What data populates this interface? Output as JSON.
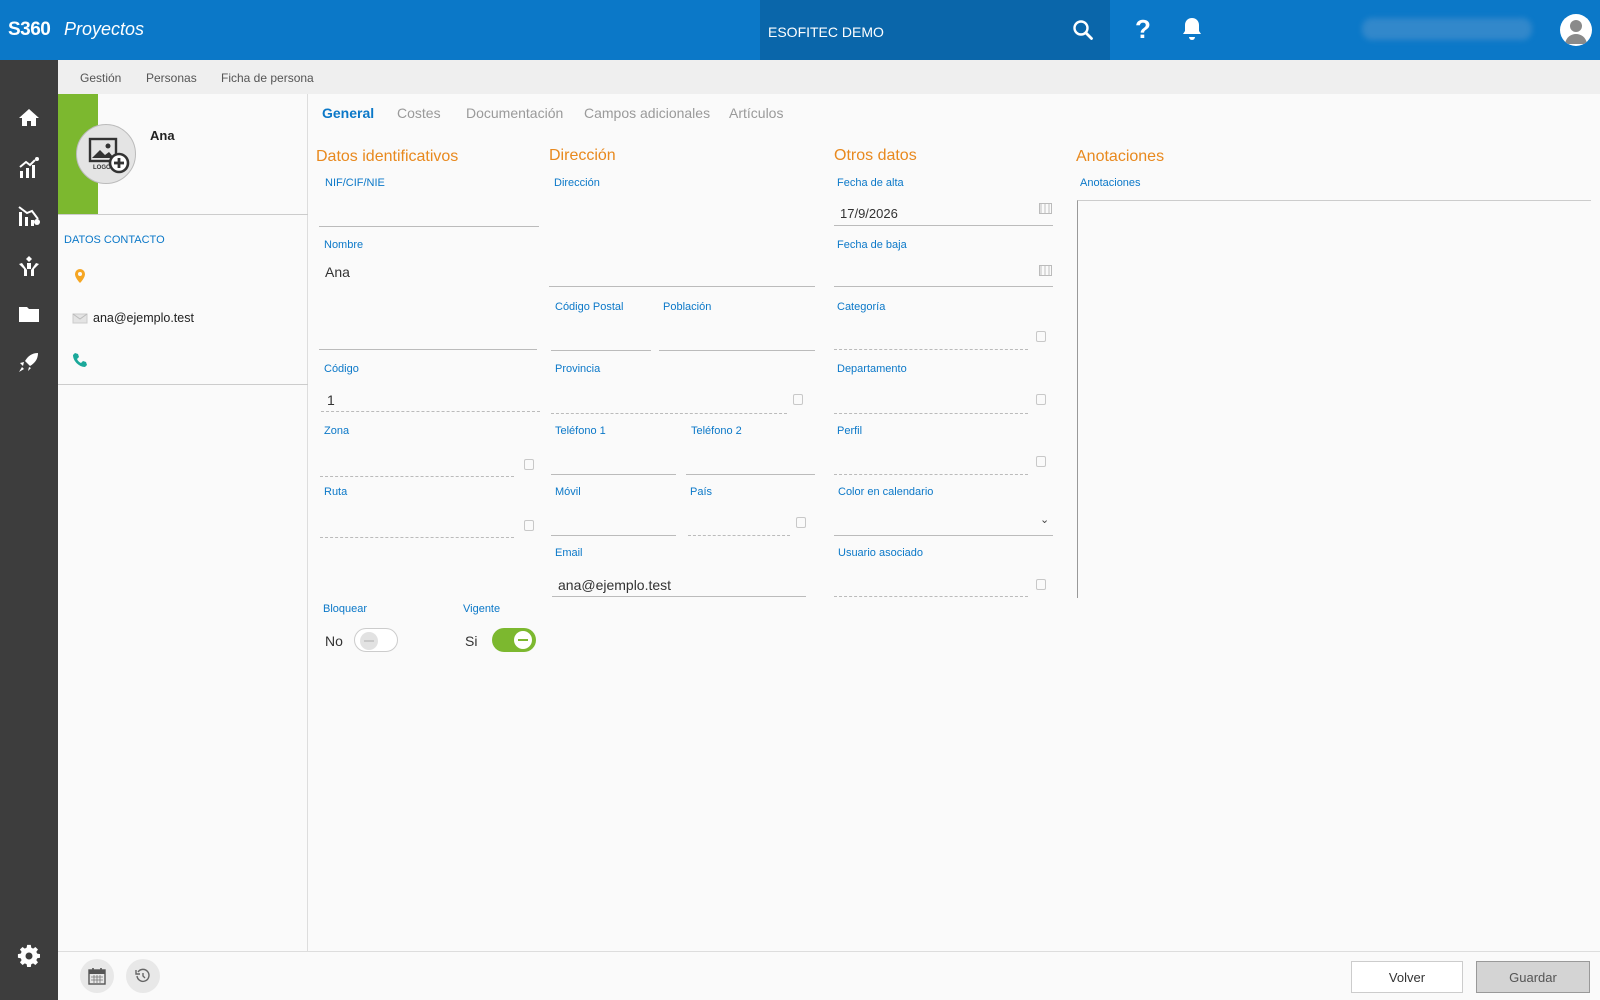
{
  "header": {
    "brand": "S360",
    "app_name": "Proyectos",
    "company": "ESOFITEC DEMO",
    "help_label": "?",
    "accent_color": "#0b78c8"
  },
  "sidebar": {
    "icons": [
      "home-icon",
      "analytics-icon",
      "projects-chart-icon",
      "hands-care-icon",
      "folder-icon",
      "rocket-icon",
      "gear-icon"
    ]
  },
  "breadcrumb": {
    "items": [
      "Gestión",
      "Personas",
      "Ficha de persona"
    ]
  },
  "profile": {
    "name": "Ana",
    "logo_text": "LOGO",
    "contact_title": "DATOS CONTACTO",
    "email": "ana@ejemplo.test"
  },
  "tabs": [
    "General",
    "Costes",
    "Documentación",
    "Campos adicionales",
    "Artículos"
  ],
  "sections": {
    "identificativos": "Datos identificativos",
    "direccion": "Dirección",
    "otros": "Otros datos",
    "anotaciones": "Anotaciones"
  },
  "fields": {
    "nif": {
      "label": "NIF/CIF/NIE",
      "value": ""
    },
    "nombre": {
      "label": "Nombre",
      "value": "Ana"
    },
    "codigo": {
      "label": "Código",
      "value": "1"
    },
    "zona": {
      "label": "Zona",
      "value": ""
    },
    "ruta": {
      "label": "Ruta",
      "value": ""
    },
    "direccion": {
      "label": "Dirección",
      "value": ""
    },
    "codigo_postal": {
      "label": "Código Postal",
      "value": ""
    },
    "poblacion": {
      "label": "Población",
      "value": ""
    },
    "provincia": {
      "label": "Provincia",
      "value": ""
    },
    "telefono1": {
      "label": "Teléfono 1",
      "value": ""
    },
    "telefono2": {
      "label": "Teléfono 2",
      "value": ""
    },
    "movil": {
      "label": "Móvil",
      "value": ""
    },
    "pais": {
      "label": "País",
      "value": ""
    },
    "email": {
      "label": "Email",
      "value": "ana@ejemplo.test"
    },
    "fecha_alta": {
      "label": "Fecha de alta",
      "value": "17/9/2026"
    },
    "fecha_baja": {
      "label": "Fecha de baja",
      "value": ""
    },
    "categoria": {
      "label": "Categoría",
      "value": ""
    },
    "departamento": {
      "label": "Departamento",
      "value": ""
    },
    "perfil": {
      "label": "Perfil",
      "value": ""
    },
    "color_calendario": {
      "label": "Color en calendario",
      "value": ""
    },
    "usuario_asociado": {
      "label": "Usuario asociado",
      "value": ""
    },
    "anotaciones": {
      "label": "Anotaciones",
      "value": ""
    }
  },
  "toggles": {
    "bloquear": {
      "label": "Bloquear",
      "state_text": "No",
      "on": false
    },
    "vigente": {
      "label": "Vigente",
      "state_text": "Si",
      "on": true
    }
  },
  "footer": {
    "volver_label": "Volver",
    "guardar_label": "Guardar"
  }
}
